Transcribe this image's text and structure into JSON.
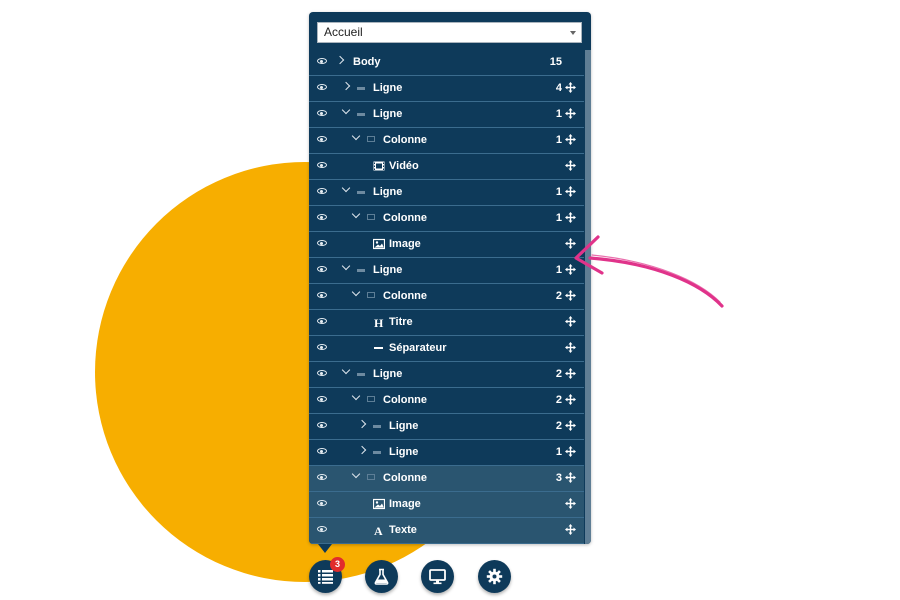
{
  "colors": {
    "panel": "#0e3a5a",
    "accent_blob": "#f7ae00",
    "arrow": "#e0338a",
    "badge": "#e12c2c"
  },
  "page_select": {
    "value": "Accueil"
  },
  "tree": [
    {
      "label": "Body",
      "count": "15",
      "depth": 0,
      "chevron": "right",
      "type": "body",
      "icon": "none",
      "move": false,
      "alt": false
    },
    {
      "label": "Ligne",
      "count": "4",
      "depth": 1,
      "chevron": "right",
      "type": "row",
      "icon": "row-icon",
      "move": true,
      "alt": false
    },
    {
      "label": "Ligne",
      "count": "1",
      "depth": 1,
      "chevron": "down",
      "type": "row",
      "icon": "row-icon",
      "move": true,
      "alt": false
    },
    {
      "label": "Colonne",
      "count": "1",
      "depth": 2,
      "chevron": "down",
      "type": "column",
      "icon": "column-icon",
      "move": true,
      "alt": false
    },
    {
      "label": "Vidéo",
      "count": "",
      "depth": 3,
      "chevron": "",
      "type": "video",
      "icon": "film-icon",
      "move": true,
      "alt": false
    },
    {
      "label": "Ligne",
      "count": "1",
      "depth": 1,
      "chevron": "down",
      "type": "row",
      "icon": "row-icon",
      "move": true,
      "alt": false
    },
    {
      "label": "Colonne",
      "count": "1",
      "depth": 2,
      "chevron": "down",
      "type": "column",
      "icon": "column-icon",
      "move": true,
      "alt": false
    },
    {
      "label": "Image",
      "count": "",
      "depth": 3,
      "chevron": "",
      "type": "image",
      "icon": "image-icon",
      "move": true,
      "alt": false
    },
    {
      "label": "Ligne",
      "count": "1",
      "depth": 1,
      "chevron": "down",
      "type": "row",
      "icon": "row-icon",
      "move": true,
      "alt": false
    },
    {
      "label": "Colonne",
      "count": "2",
      "depth": 2,
      "chevron": "down",
      "type": "column",
      "icon": "column-icon",
      "move": true,
      "alt": false
    },
    {
      "label": "Titre",
      "count": "",
      "depth": 3,
      "chevron": "",
      "type": "title",
      "icon": "heading-icon",
      "move": true,
      "alt": false
    },
    {
      "label": "Séparateur",
      "count": "",
      "depth": 3,
      "chevron": "",
      "type": "separator",
      "icon": "separator-icon",
      "move": true,
      "alt": false
    },
    {
      "label": "Ligne",
      "count": "2",
      "depth": 1,
      "chevron": "down",
      "type": "row",
      "icon": "row-icon",
      "move": true,
      "alt": false
    },
    {
      "label": "Colonne",
      "count": "2",
      "depth": 2,
      "chevron": "down",
      "type": "column",
      "icon": "column-icon",
      "move": true,
      "alt": false
    },
    {
      "label": "Ligne",
      "count": "2",
      "depth": 3,
      "chevron": "right",
      "type": "row",
      "icon": "row-icon",
      "move": true,
      "alt": false
    },
    {
      "label": "Ligne",
      "count": "1",
      "depth": 3,
      "chevron": "right",
      "type": "row",
      "icon": "row-icon",
      "move": true,
      "alt": false
    },
    {
      "label": "Colonne",
      "count": "3",
      "depth": 2,
      "chevron": "down",
      "type": "column",
      "icon": "column-icon",
      "move": true,
      "alt": true
    },
    {
      "label": "Image",
      "count": "",
      "depth": 3,
      "chevron": "",
      "type": "image",
      "icon": "image-icon",
      "move": true,
      "alt": true
    },
    {
      "label": "Texte",
      "count": "",
      "depth": 3,
      "chevron": "",
      "type": "text",
      "icon": "text-icon",
      "move": true,
      "alt": true
    }
  ],
  "dock": {
    "badge_count": "3",
    "buttons": [
      {
        "name": "layers-button",
        "icon": "list-icon"
      },
      {
        "name": "experiment-button",
        "icon": "flask-icon"
      },
      {
        "name": "preview-button",
        "icon": "monitor-icon"
      },
      {
        "name": "settings-button",
        "icon": "gear-icon"
      }
    ]
  }
}
